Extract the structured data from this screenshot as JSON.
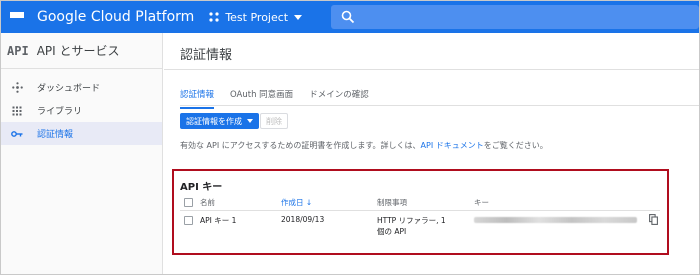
{
  "topbar": {
    "brand": "Google Cloud Platform",
    "project": "Test Project",
    "color": "#1a73e8"
  },
  "sidebar": {
    "logo": "API",
    "title": "API とサービス",
    "items": [
      {
        "label": "ダッシュボード",
        "icon": "dashboard-icon",
        "active": false
      },
      {
        "label": "ライブラリ",
        "icon": "library-icon",
        "active": false
      },
      {
        "label": "認証情報",
        "icon": "key-icon",
        "active": true
      }
    ]
  },
  "main": {
    "title": "認証情報",
    "tabs": [
      {
        "label": "認証情報",
        "active": true
      },
      {
        "label": "OAuth 同意画面",
        "active": false
      },
      {
        "label": "ドメインの確認",
        "active": false
      }
    ],
    "create_button": "認証情報を作成",
    "delete_button": "削除",
    "description_prefix": "有効な API にアクセスするための証明書を作成します。詳しくは、",
    "description_link": "API ドキュメント",
    "description_suffix": "をご覧ください。"
  },
  "api_keys": {
    "section_title": "API キー",
    "columns": {
      "name": "名前",
      "created": "作成日",
      "restrictions": "制限事項",
      "key": "キー"
    },
    "rows": [
      {
        "name": "API キー 1",
        "created": "2018/09/13",
        "restriction_line1": "HTTP リファラー, 1",
        "restriction_line2": "個の API"
      }
    ],
    "highlight_color": "#b00d1e"
  }
}
